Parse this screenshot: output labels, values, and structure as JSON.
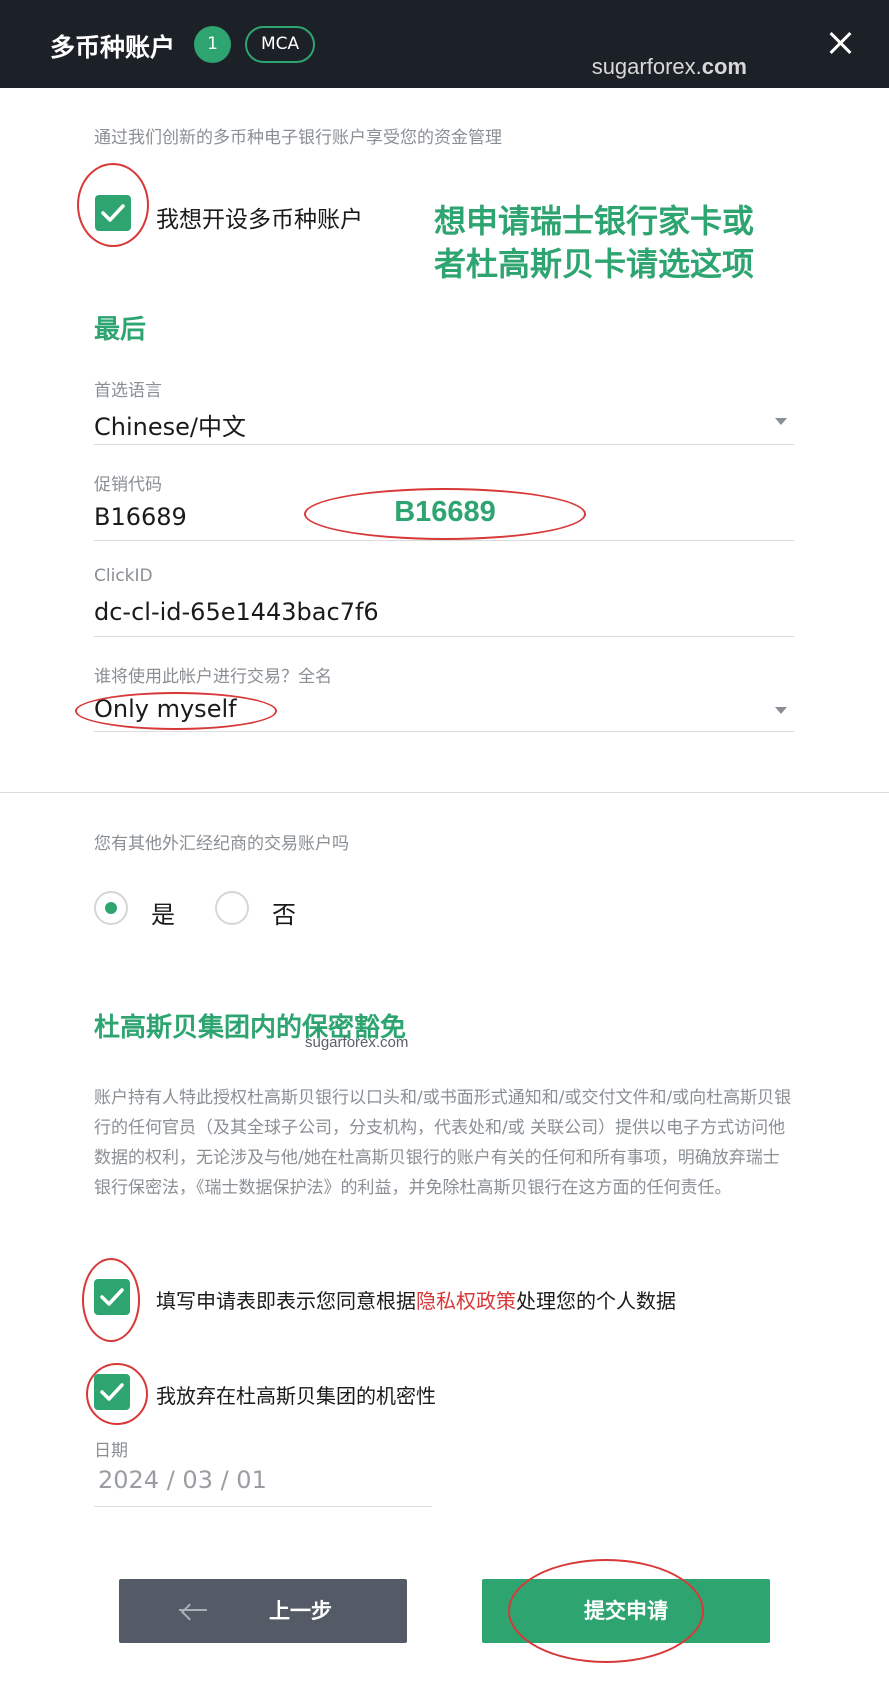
{
  "header": {
    "title": "多币种账户",
    "count": "1",
    "tag": "MCA",
    "watermark_prefix": "sugarforex.",
    "watermark_suffix": "com"
  },
  "intro": "通过我们创新的多币种电子银行账户享受您的资金管理",
  "mca_checkbox": {
    "label": "我想开设多币种账户",
    "checked": true
  },
  "annotation": {
    "line1": "想申请瑞士银行家卡或",
    "line2": "者杜高斯贝卡请选这项"
  },
  "final_section": {
    "title": "最后",
    "language": {
      "label": "首选语言",
      "value": "Chinese/中文"
    },
    "promo": {
      "label": "促销代码",
      "value": "B16689",
      "callout": "B16689"
    },
    "clickid": {
      "label": "ClickID",
      "value": "dc-cl-id-65e1443bac7f6"
    },
    "trader": {
      "label": "谁将使用此帐户进行交易？全名",
      "value": "Only myself"
    }
  },
  "other_broker": {
    "question": "您有其他外汇经纪商的交易账户吗",
    "options": [
      {
        "label": "是",
        "selected": true
      },
      {
        "label": "否",
        "selected": false
      }
    ]
  },
  "waiver": {
    "title": "杜高斯贝集团内的保密豁免",
    "watermark": "sugarforex.com",
    "text": "账户持有人特此授权杜高斯贝银行以口头和/或书面形式通知和/或交付文件和/或向杜高斯贝银行的任何官员（及其全球子公司，分支机构，代表处和/或 关联公司）提供以电子方式访问他数据的权利，无论涉及与他/她在杜高斯贝银行的账户有关的任何和所有事项，明确放弃瑞士银行保密法，《瑞士数据保护法》的利益，并免除杜高斯贝银行在这方面的任何责任。",
    "privacy_checkbox": {
      "prefix": "填写申请表即表示您同意根据",
      "link": "隐私权政策",
      "suffix": "处理您的个人数据",
      "checked": true
    },
    "confidentiality_checkbox": {
      "label": "我放弃在杜高斯贝集团的机密性",
      "checked": true
    },
    "date": {
      "label": "日期",
      "value": "2024 / 03 / 01"
    }
  },
  "buttons": {
    "back": "上一步",
    "submit": "提交申请"
  },
  "colors": {
    "accent": "#2ea570",
    "annotation_ring": "#d93838",
    "header_bg": "#1c2127"
  }
}
